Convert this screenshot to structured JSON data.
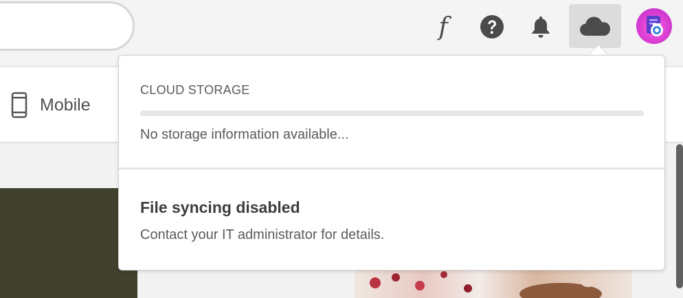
{
  "header": {
    "search_placeholder": "",
    "fonts_glyph": "f",
    "icons": {
      "fonts": "fonts-icon",
      "help": "help-icon",
      "notifications": "bell-icon",
      "cloud": "cloud-icon",
      "avatar": "user-avatar"
    }
  },
  "subnav": {
    "mobile_label": "Mobile"
  },
  "cloud_popover": {
    "storage_heading": "CLOUD STORAGE",
    "storage_used_fraction": 0,
    "storage_status": "No storage information available...",
    "sync_title": "File syncing disabled",
    "sync_description": "Contact your IT administrator for details."
  },
  "colors": {
    "accent_avatar": "#d63bd1",
    "dark_block": "#41412e",
    "text_primary": "#3e3e3e",
    "text_secondary": "#5a5a5a"
  }
}
